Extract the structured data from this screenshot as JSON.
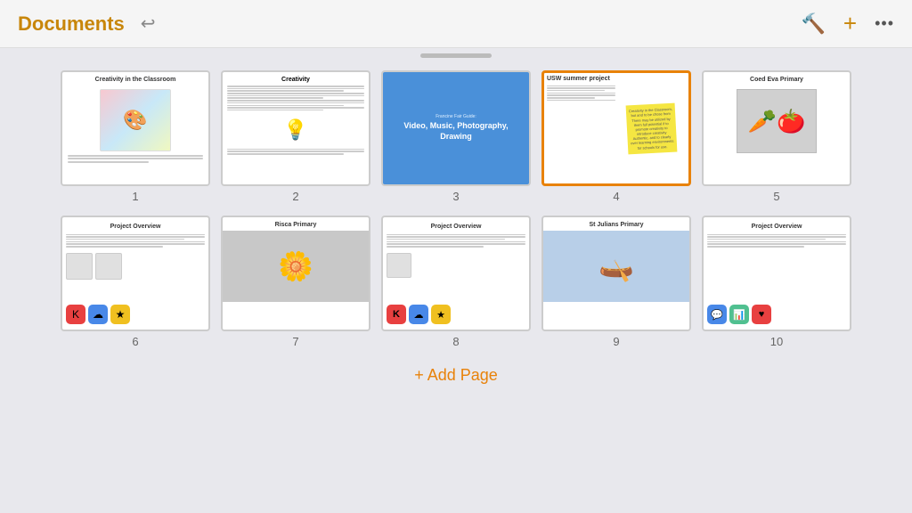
{
  "header": {
    "title": "Documents",
    "back_label": "↩",
    "icon_hammer": "🔨",
    "icon_plus": "+",
    "icon_more": "···"
  },
  "pages": [
    {
      "number": "1",
      "title": "Creativity in the Classroom",
      "type": "image-text",
      "selected": false
    },
    {
      "number": "2",
      "title": "Creativity",
      "type": "text",
      "selected": false
    },
    {
      "number": "3",
      "title": "Video, Music, Photography, Drawing",
      "subtitle": "Francine Fair Guide:",
      "type": "cover-blue",
      "selected": false
    },
    {
      "number": "4",
      "title": "USW summer project",
      "type": "text-sticky",
      "selected": true,
      "sticky_text": "Creativity in the Classroom, but and to be chose from There may be utilized by them full potential if to promote creativity to introduce creativity Authentic, and to clearly over learning environments for schools for use."
    },
    {
      "number": "5",
      "title": "Coed Eva Primary",
      "type": "image-grey",
      "selected": false
    },
    {
      "number": "6",
      "title": "Project Overview",
      "type": "text-apps",
      "selected": false
    },
    {
      "number": "7",
      "title": "Risca Primary",
      "type": "image-grey2",
      "selected": false
    },
    {
      "number": "8",
      "title": "Project Overview",
      "type": "text-apps2",
      "selected": false
    },
    {
      "number": "9",
      "title": "St Julians Primary",
      "type": "image-blue",
      "selected": false
    },
    {
      "number": "10",
      "title": "Project Overview",
      "type": "text-apps3",
      "selected": false
    }
  ],
  "add_page": "+ Add Page"
}
